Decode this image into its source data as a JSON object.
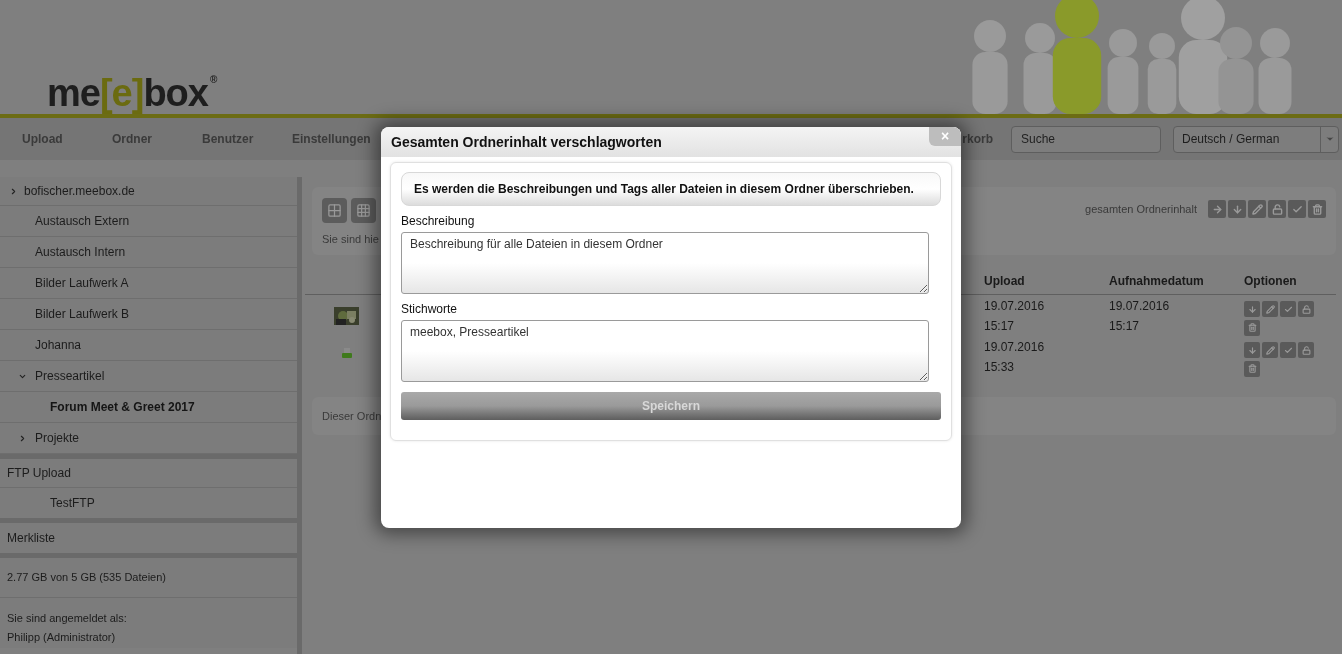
{
  "header": {
    "logo": {
      "before": "me",
      "bracketed": "[e]",
      "after": "box",
      "registered": "®"
    }
  },
  "nav": {
    "items": [
      "Upload",
      "Ordner",
      "Benutzer",
      "Einstellungen"
    ],
    "cart_partial": "rkorb",
    "search": {
      "placeholder": "Suche"
    },
    "language": "Deutsch / German"
  },
  "sidebar": {
    "root": {
      "label": "bofischer.meebox.de",
      "kind": "branch",
      "expanded": false
    },
    "folders": [
      {
        "label": "Austausch Extern",
        "kind": "leaf",
        "selected": false
      },
      {
        "label": "Austausch Intern",
        "kind": "leaf",
        "selected": false
      },
      {
        "label": "Bilder Laufwerk A",
        "kind": "leaf",
        "selected": false
      },
      {
        "label": "Bilder Laufwerk B",
        "kind": "leaf",
        "selected": false
      },
      {
        "label": "Johanna",
        "kind": "leaf",
        "selected": false
      },
      {
        "label": "Presseartikel",
        "kind": "branch",
        "expanded": true,
        "selected": false,
        "children": [
          {
            "label": "Forum Meet & Greet 2017",
            "kind": "leaf",
            "selected": true
          }
        ]
      },
      {
        "label": "Projekte",
        "kind": "branch",
        "expanded": false,
        "selected": false
      }
    ],
    "ftp": {
      "title": "FTP Upload",
      "items": [
        "TestFTP"
      ]
    },
    "watchlist": "Merkliste",
    "storage": "2.77 GB von 5 GB (535 Dateien)",
    "login": [
      "Sie sind angemeldet als:",
      "Philipp (Administrator)"
    ]
  },
  "main": {
    "breadcrumb_partial": "Sie sind hie",
    "bulk_label": "gesamten Ordnerinhalt",
    "table": {
      "columns": [
        "Upload",
        "Aufnahmedatum",
        "Optionen"
      ],
      "rows": [
        {
          "upload": [
            "19.07.2016",
            "15:17"
          ],
          "recorded": [
            "19.07.2016",
            "15:17"
          ]
        },
        {
          "kind": "file",
          "upload": [
            "19.07.2016",
            "15:33"
          ]
        }
      ]
    },
    "footer_partial": "Dieser Ordn"
  },
  "dialog": {
    "title": "Gesamten Ordnerinhalt verschlagworten",
    "close": "×",
    "notice": "Es werden die Beschreibungen und Tags aller Dateien in diesem Ordner überschrieben.",
    "fields": [
      {
        "label": "Beschreibung",
        "value": "Beschreibung für alle Dateien in diesem Ordner"
      },
      {
        "label": "Stichworte",
        "value": "meebox, Presseartikel"
      }
    ],
    "button": {
      "label": "Speichern",
      "disabled": true
    }
  }
}
